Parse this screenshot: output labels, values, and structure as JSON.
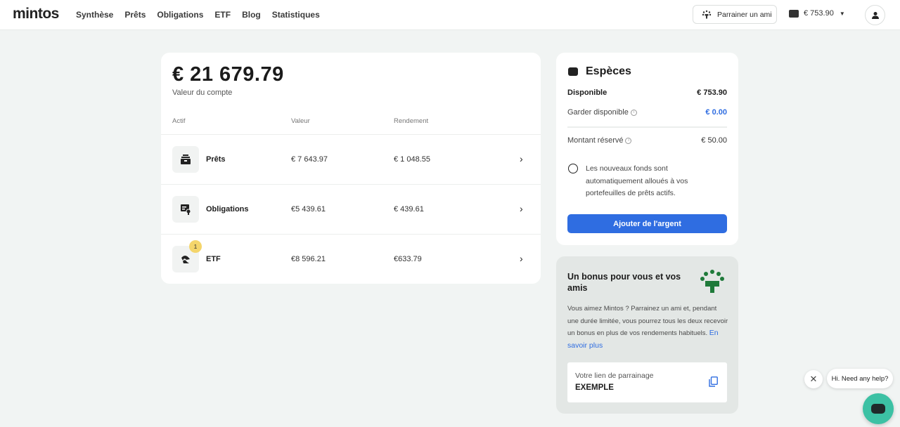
{
  "header": {
    "logo": "mintos",
    "nav": [
      "Synthèse",
      "Prêts",
      "Obligations",
      "ETF",
      "Blog",
      "Statistiques"
    ],
    "refer_label": "Parrainer un ami",
    "wallet_amount": "€ 753.90"
  },
  "account": {
    "value": "€ 21 679.79",
    "label": "Valeur du compte",
    "columns": [
      "Actif",
      "Valeur",
      "Rendement"
    ],
    "rows": [
      {
        "name": "Prêts",
        "value": "€ 7 643.97",
        "return": "€ 1 048.55"
      },
      {
        "name": "Obligations",
        "value": "€5 439.61",
        "return": "€ 439.61"
      },
      {
        "name": "ETF",
        "value": "€8 596.21",
        "return": "€633.79",
        "badge": "1"
      }
    ]
  },
  "cash": {
    "title": "Espèces",
    "available_label": "Disponible",
    "available_value": "€ 753.90",
    "keep_label": "Garder disponible",
    "keep_value": "€ 0.00",
    "reserved_label": "Montant réservé",
    "reserved_value": "€ 50.00",
    "note": "Les nouveaux fonds sont automatiquement alloués à vos portefeuilles de prêts actifs.",
    "add_button": "Ajouter de l'argent"
  },
  "bonus": {
    "title": "Un bonus pour vous et vos amis",
    "text": "Vous aimez Mintos ? Parrainez un ami et, pendant une durée limitée, vous pourrez tous les deux recevoir un bonus en plus de vos rendements habituels.",
    "link": "En savoir plus",
    "ref_label": "Votre lien de parrainage",
    "ref_code": "EXEMPLE"
  },
  "chat": {
    "greeting": "Hi. Need any help?",
    "close": "✕"
  },
  "colors": {
    "accent": "#2f6de1",
    "chat": "#3cc1a4",
    "badge": "#f4d56b",
    "bonus_green": "#1f7a3a"
  }
}
